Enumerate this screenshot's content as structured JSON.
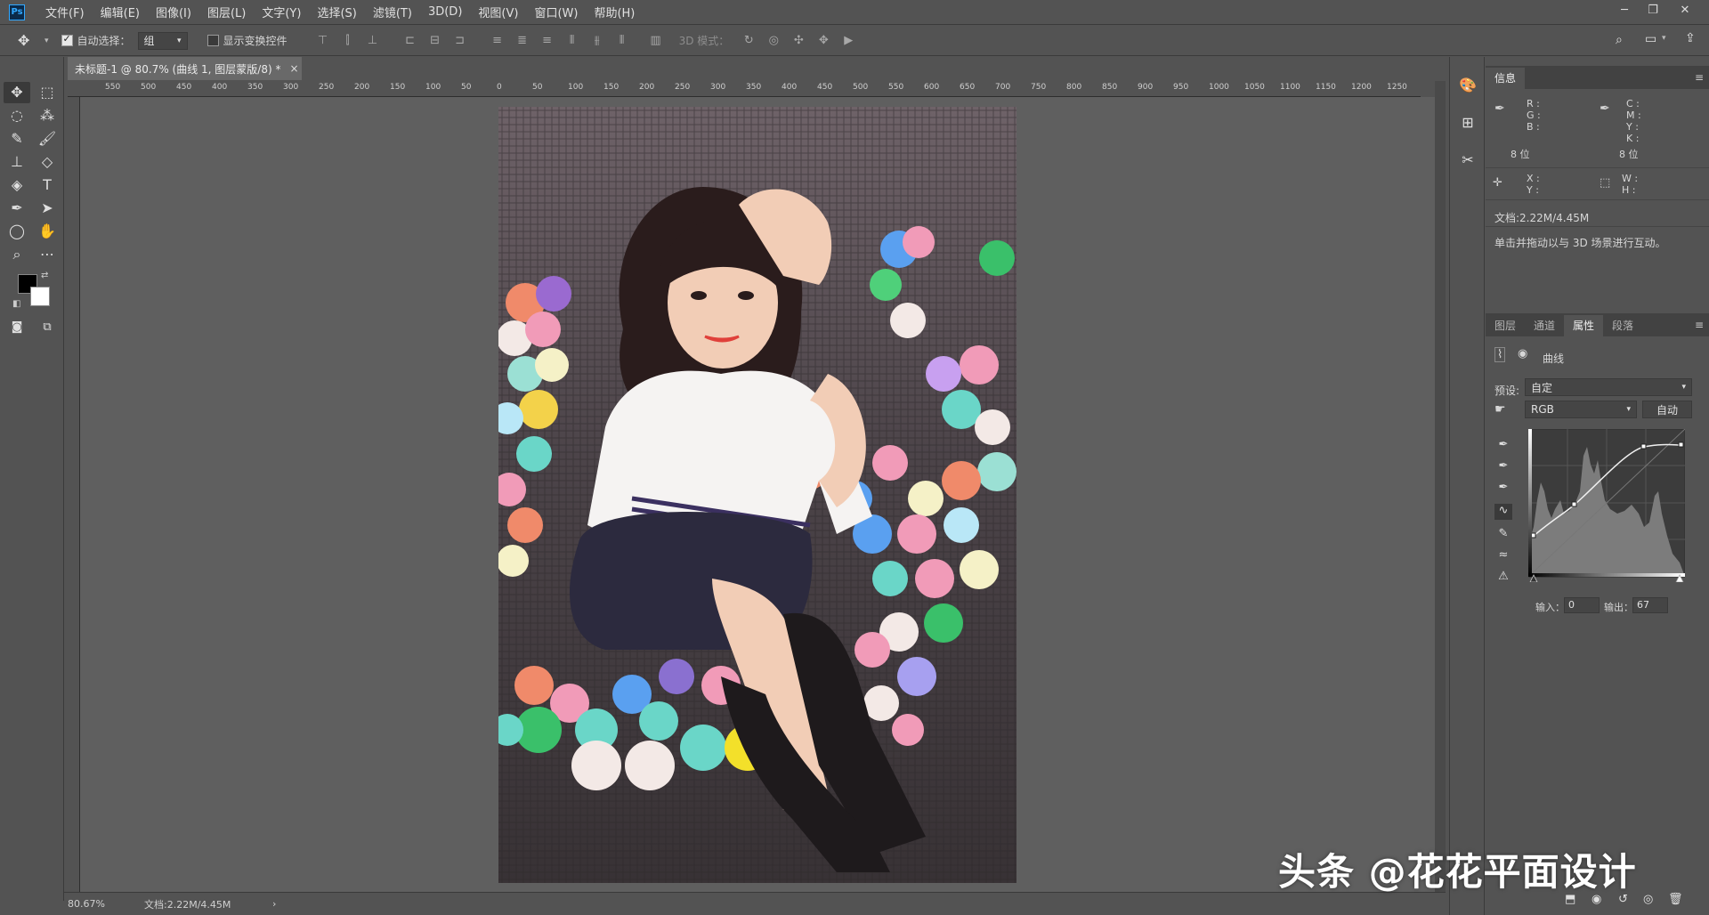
{
  "menu": {
    "logo": "Ps",
    "items": [
      "文件(F)",
      "编辑(E)",
      "图像(I)",
      "图层(L)",
      "文字(Y)",
      "选择(S)",
      "滤镜(T)",
      "3D(D)",
      "视图(V)",
      "窗口(W)",
      "帮助(H)"
    ]
  },
  "window_controls": {
    "minimize": "─",
    "restore": "❐",
    "close": "✕"
  },
  "options": {
    "auto_select_label": "自动选择：",
    "auto_select_value": "组",
    "show_transform_label": "显示变换控件",
    "mode_3d_label": "3D 模式："
  },
  "document": {
    "tab_title": "未标题-1 @ 80.7% (曲线 1, 图层蒙版/8) *",
    "tab_close": "×"
  },
  "ruler_top": [
    "550",
    "500",
    "450",
    "400",
    "350",
    "300",
    "250",
    "200",
    "150",
    "100",
    "50",
    "0",
    "50",
    "100",
    "150",
    "200",
    "250",
    "300",
    "350",
    "400",
    "450",
    "500",
    "550",
    "600",
    "650",
    "700",
    "750",
    "800",
    "850",
    "900",
    "950",
    "1000",
    "1050",
    "1100",
    "1150",
    "1200",
    "1250"
  ],
  "status": {
    "zoom": "80.67%",
    "doc_size": "文档:2.22M/4.45M",
    "arrow": "›"
  },
  "info_panel": {
    "tab": "信息",
    "r": "R :",
    "g": "G :",
    "b": "B :",
    "c": "C :",
    "m": "M :",
    "y": "Y :",
    "k": "K :",
    "bits_left": "8 位",
    "bits_right": "8 位",
    "x": "X :",
    "y2": "Y :",
    "w": "W :",
    "h": "H :",
    "doc": "文档:2.22M/4.45M",
    "hint": "单击并拖动以与 3D 场景进行互动。"
  },
  "props_panel": {
    "tabs": [
      "图层",
      "通道",
      "属性",
      "段落"
    ],
    "active_tab": "属性",
    "title": "曲线",
    "preset_label": "预设:",
    "preset_value": "自定",
    "channel_value": "RGB",
    "auto_button": "自动",
    "input_label": "输入：",
    "input_value": "0",
    "output_label": "输出：",
    "output_value": "67"
  },
  "watermark": "头条 @花花平面设计",
  "colors": {
    "accent": "#31a8ff",
    "panel_bg": "#535353",
    "canvas_bg": "#5f5f5f"
  }
}
